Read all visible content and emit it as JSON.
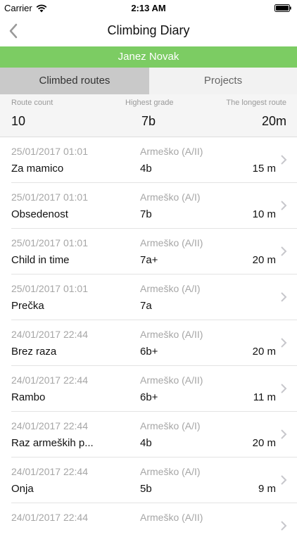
{
  "status_bar": {
    "carrier": "Carrier",
    "time": "2:13 AM"
  },
  "nav": {
    "title": "Climbing Diary"
  },
  "user": {
    "name": "Janez Novak"
  },
  "tabs": [
    {
      "label": "Climbed routes",
      "active": true
    },
    {
      "label": "Projects",
      "active": false
    }
  ],
  "stats": {
    "route_count_label": "Route count",
    "route_count_value": "10",
    "highest_grade_label": "Highest grade",
    "highest_grade_value": "7b",
    "longest_route_label": "The longest route",
    "longest_route_value": "20m"
  },
  "colors": {
    "accent_green": "#7ccc63",
    "tab_active_bg": "#c9c9c9",
    "muted_text": "#a6a6a6"
  },
  "routes": [
    {
      "date": "25/01/2017 01:01",
      "area": "Armeško (A/II)",
      "name": "Za mamico",
      "grade": "4b",
      "length": "15 m"
    },
    {
      "date": "25/01/2017 01:01",
      "area": "Armeško (A/I)",
      "name": "Obsedenost",
      "grade": "7b",
      "length": "10 m"
    },
    {
      "date": "25/01/2017 01:01",
      "area": "Armeško (A/II)",
      "name": "Child in time",
      "grade": "7a+",
      "length": "20 m"
    },
    {
      "date": "25/01/2017 01:01",
      "area": "Armeško (A/I)",
      "name": "Prečka",
      "grade": "7a",
      "length": ""
    },
    {
      "date": "24/01/2017 22:44",
      "area": "Armeško (A/II)",
      "name": "Brez raza",
      "grade": "6b+",
      "length": "20 m"
    },
    {
      "date": "24/01/2017 22:44",
      "area": "Armeško (A/II)",
      "name": "Rambo",
      "grade": "6b+",
      "length": "11 m"
    },
    {
      "date": "24/01/2017 22:44",
      "area": "Armeško (A/I)",
      "name": "Raz armeških p...",
      "grade": "4b",
      "length": "20 m"
    },
    {
      "date": "24/01/2017 22:44",
      "area": "Armeško (A/I)",
      "name": "Onja",
      "grade": "5b",
      "length": "9 m"
    },
    {
      "date": "24/01/2017 22:44",
      "area": "Armeško (A/II)",
      "name": "",
      "grade": "",
      "length": ""
    }
  ]
}
